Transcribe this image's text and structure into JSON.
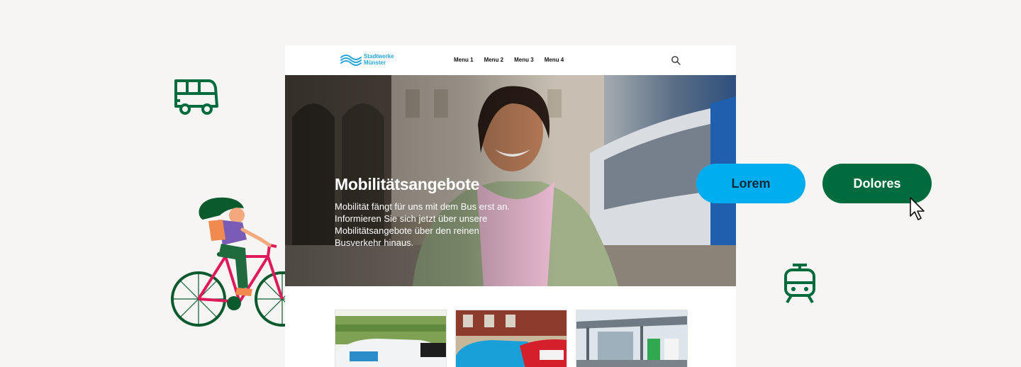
{
  "site": {
    "logo_line1": "Stadtwerke",
    "logo_line2": "Münster",
    "menu": [
      {
        "label": "Menu 1"
      },
      {
        "label": "Menu 2"
      },
      {
        "label": "Menu 3"
      },
      {
        "label": "Menu 4"
      }
    ]
  },
  "hero": {
    "title": "Mobilitätsangebote",
    "text": "Mobilität fängt für uns mit dem Bus erst an. Informieren Sie sich jetzt über unsere Mobilitätsangebote über den reinen Busverkehr hinaus."
  },
  "buttons": {
    "lorem": "Lorem",
    "dolores": "Dolores"
  },
  "colors": {
    "brand_green": "#006b3c",
    "brand_blue": "#00aeef",
    "logo_blue": "#27a6d9",
    "background": "#f6f5f3"
  },
  "icons": [
    "bus-icon",
    "tram-icon",
    "cyclist-illustration",
    "search-icon",
    "cursor-arrow-icon"
  ]
}
